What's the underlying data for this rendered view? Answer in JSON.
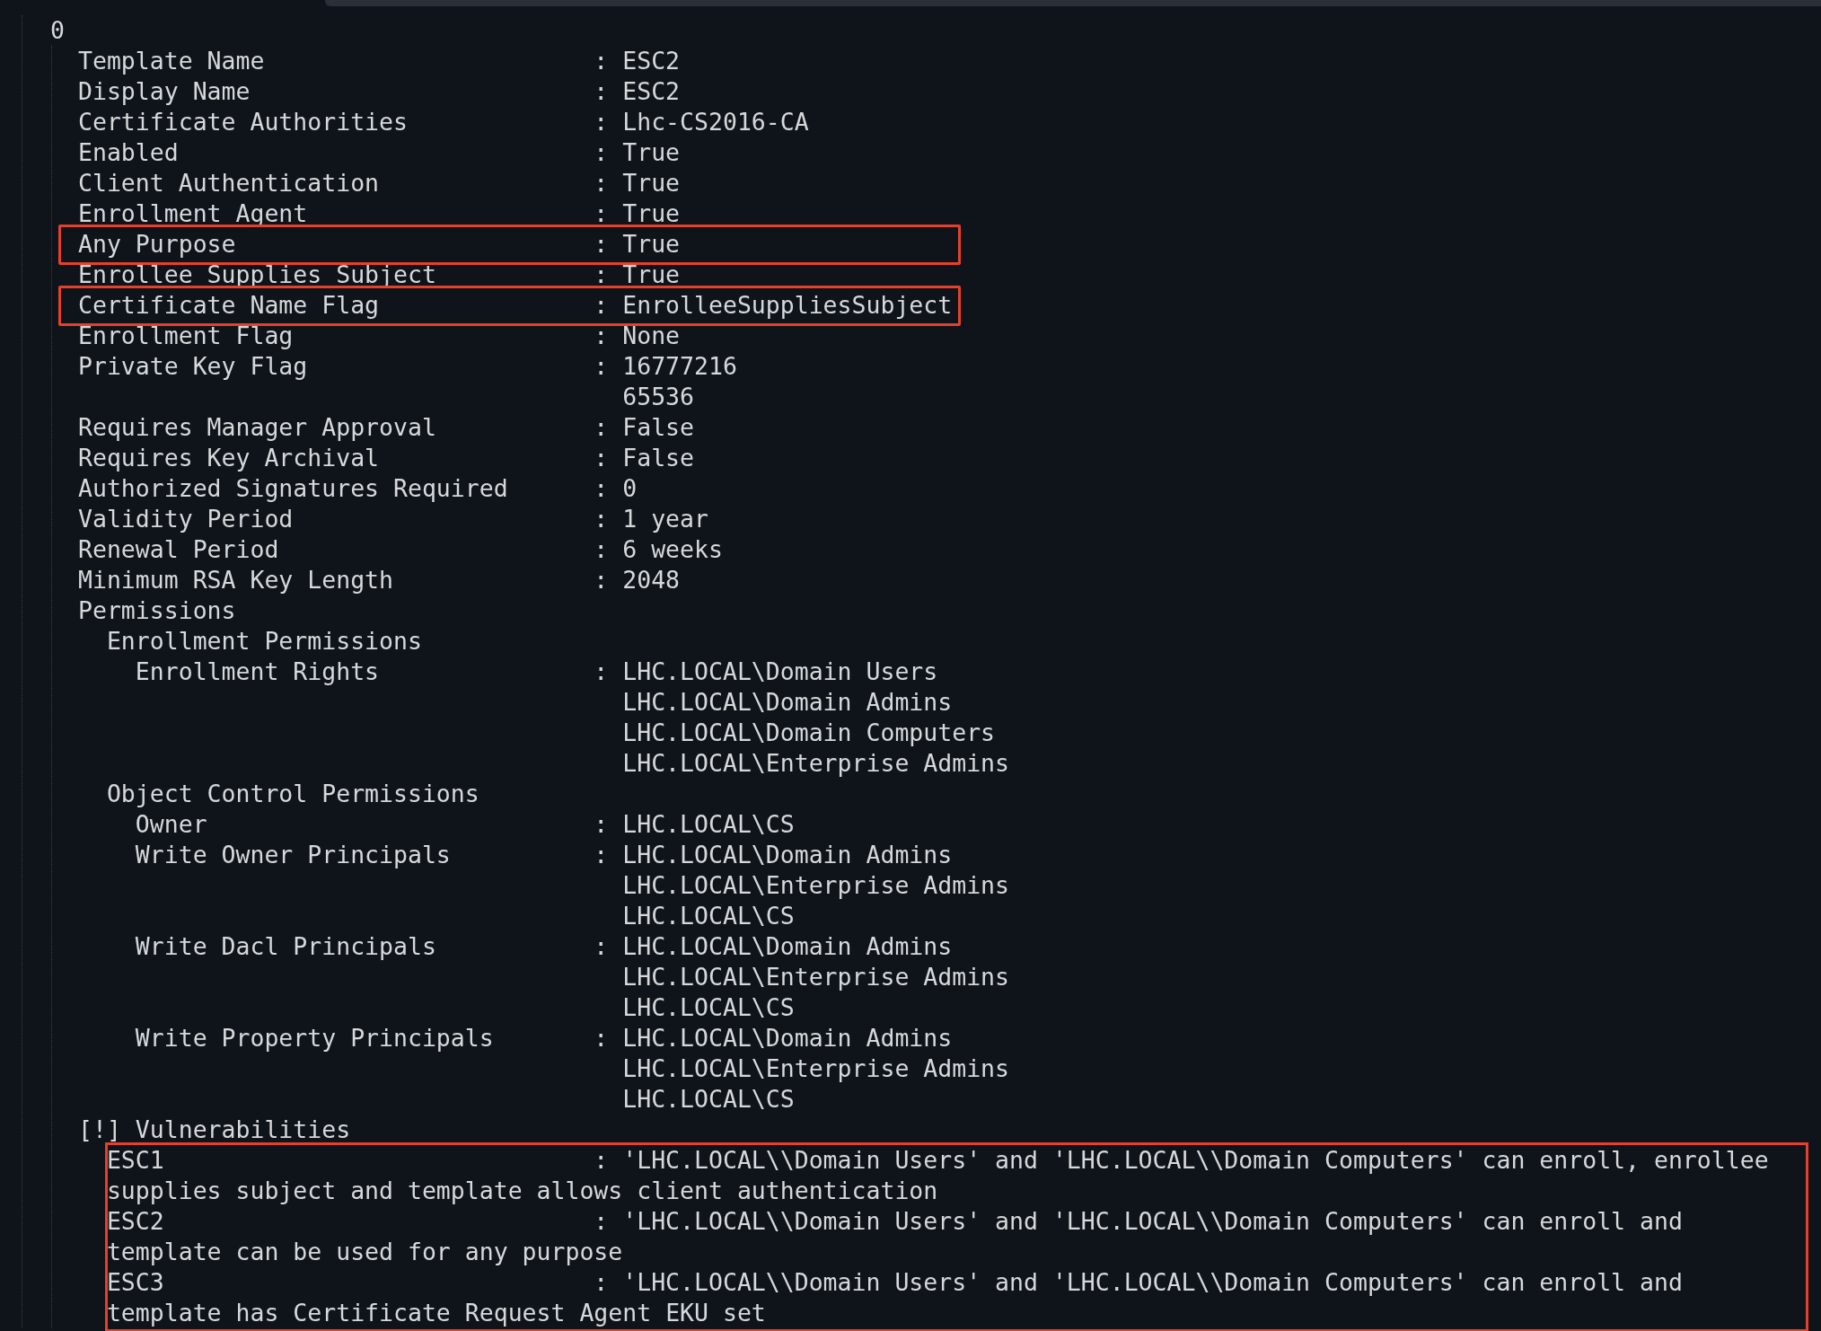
{
  "index": "0",
  "separator": ":",
  "fields": [
    {
      "label": "Template Name",
      "values": [
        "ESC2"
      ],
      "highlighted": false
    },
    {
      "label": "Display Name",
      "values": [
        "ESC2"
      ],
      "highlighted": false
    },
    {
      "label": "Certificate Authorities",
      "values": [
        "Lhc-CS2016-CA"
      ],
      "highlighted": false
    },
    {
      "label": "Enabled",
      "values": [
        "True"
      ],
      "highlighted": false
    },
    {
      "label": "Client Authentication",
      "values": [
        "True"
      ],
      "highlighted": false
    },
    {
      "label": "Enrollment Agent",
      "values": [
        "True"
      ],
      "highlighted": false
    },
    {
      "label": "Any Purpose",
      "values": [
        "True"
      ],
      "highlighted": true
    },
    {
      "label": "Enrollee Supplies Subject",
      "values": [
        "True"
      ],
      "highlighted": false
    },
    {
      "label": "Certificate Name Flag",
      "values": [
        "EnrolleeSuppliesSubject"
      ],
      "highlighted": true
    },
    {
      "label": "Enrollment Flag",
      "values": [
        "None"
      ],
      "highlighted": false
    },
    {
      "label": "Private Key Flag",
      "values": [
        "16777216",
        "65536"
      ],
      "highlighted": false
    },
    {
      "label": "Requires Manager Approval",
      "values": [
        "False"
      ],
      "highlighted": false
    },
    {
      "label": "Requires Key Archival",
      "values": [
        "False"
      ],
      "highlighted": false
    },
    {
      "label": "Authorized Signatures Required",
      "values": [
        "0"
      ],
      "highlighted": false
    },
    {
      "label": "Validity Period",
      "values": [
        "1 year"
      ],
      "highlighted": false
    },
    {
      "label": "Renewal Period",
      "values": [
        "6 weeks"
      ],
      "highlighted": false
    },
    {
      "label": "Minimum RSA Key Length",
      "values": [
        "2048"
      ],
      "highlighted": false
    }
  ],
  "permissions": {
    "title": "Permissions",
    "groups": [
      {
        "title": "Enrollment Permissions",
        "entries": [
          {
            "label": "Enrollment Rights",
            "values": [
              "LHC.LOCAL\\Domain Users",
              "LHC.LOCAL\\Domain Admins",
              "LHC.LOCAL\\Domain Computers",
              "LHC.LOCAL\\Enterprise Admins"
            ]
          }
        ]
      },
      {
        "title": "Object Control Permissions",
        "entries": [
          {
            "label": "Owner",
            "values": [
              "LHC.LOCAL\\CS"
            ]
          },
          {
            "label": "Write Owner Principals",
            "values": [
              "LHC.LOCAL\\Domain Admins",
              "LHC.LOCAL\\Enterprise Admins",
              "LHC.LOCAL\\CS"
            ]
          },
          {
            "label": "Write Dacl Principals",
            "values": [
              "LHC.LOCAL\\Domain Admins",
              "LHC.LOCAL\\Enterprise Admins",
              "LHC.LOCAL\\CS"
            ]
          },
          {
            "label": "Write Property Principals",
            "values": [
              "LHC.LOCAL\\Domain Admins",
              "LHC.LOCAL\\Enterprise Admins",
              "LHC.LOCAL\\CS"
            ]
          }
        ]
      }
    ]
  },
  "vulnerabilities": {
    "title": "[!] Vulnerabilities",
    "highlighted": true,
    "items": [
      {
        "id": "ESC1",
        "lines": [
          "'LHC.LOCAL\\\\Domain Users' and 'LHC.LOCAL\\\\Domain Computers' can enroll, enrollee",
          "supplies subject and template allows client authentication"
        ]
      },
      {
        "id": "ESC2",
        "lines": [
          "'LHC.LOCAL\\\\Domain Users' and 'LHC.LOCAL\\\\Domain Computers' can enroll and",
          "template can be used for any purpose"
        ]
      },
      {
        "id": "ESC3",
        "lines": [
          "'LHC.LOCAL\\\\Domain Users' and 'LHC.LOCAL\\\\Domain Computers' can enroll and",
          "template has Certificate Request Agent EKU set"
        ]
      }
    ]
  }
}
